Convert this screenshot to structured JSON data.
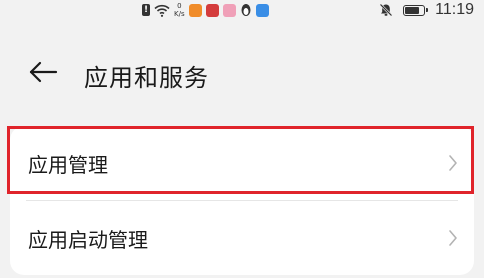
{
  "status_bar": {
    "net_speed_value": "0",
    "net_speed_unit": "K/s",
    "time": "11:19",
    "battery_level": 0.85,
    "colors": {
      "app1": "#f08c2a",
      "app2": "#d43c3c",
      "app3": "#f0a0b8",
      "app5": "#3a8ee6"
    }
  },
  "header": {
    "title": "应用和服务",
    "back_icon": "arrow-left-icon"
  },
  "settings_list": {
    "items": [
      {
        "label": "应用管理",
        "highlighted": true
      },
      {
        "label": "应用启动管理",
        "highlighted": false
      }
    ]
  },
  "highlight_color": "#e0242b"
}
